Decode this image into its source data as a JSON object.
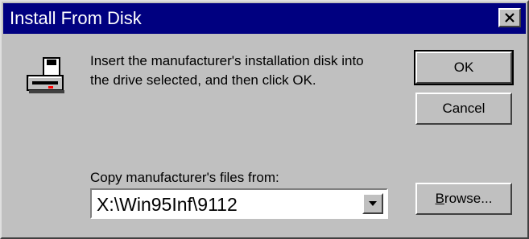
{
  "window": {
    "title": "Install From Disk"
  },
  "message": {
    "line1": "Insert the manufacturer's installation disk into",
    "line2": "the drive selected, and then click OK."
  },
  "buttons": {
    "ok": "OK",
    "cancel": "Cancel",
    "browse_accel": "B",
    "browse_rest": "rowse..."
  },
  "copy": {
    "label": "Copy manufacturer's files from:",
    "value": "X:\\Win95Inf\\9112"
  },
  "icons": {
    "close": "close-icon",
    "disk": "disk-drive-icon",
    "dropdown": "chevron-down-icon"
  },
  "colors": {
    "titlebar": "#000080",
    "face": "#c0c0c0"
  }
}
